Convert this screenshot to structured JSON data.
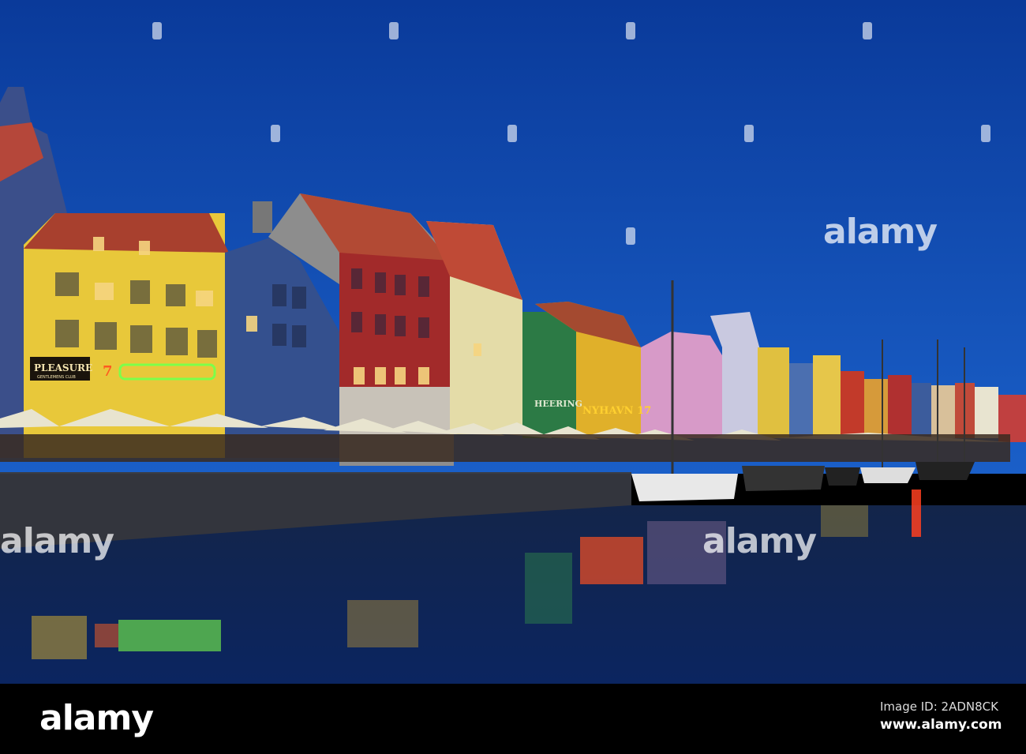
{
  "photo": {
    "subject": "Nyhavn harbour at dusk",
    "signs": {
      "pleasure": "PLEASURE",
      "pleasure_sub": "GENTLEMENS CLUB",
      "number_seven": "7",
      "heering": "HEERING",
      "nyhavn": "NYHAVN 17"
    },
    "colors": {
      "sky_top": "#0a3a9a",
      "sky_bottom": "#1a5fc8",
      "water": "#0a1a3a"
    }
  },
  "watermark": {
    "text": "alamy"
  },
  "footer": {
    "logo": "alamy",
    "image_id": "Image ID: 2ADN8CK",
    "url": "www.alamy.com"
  }
}
